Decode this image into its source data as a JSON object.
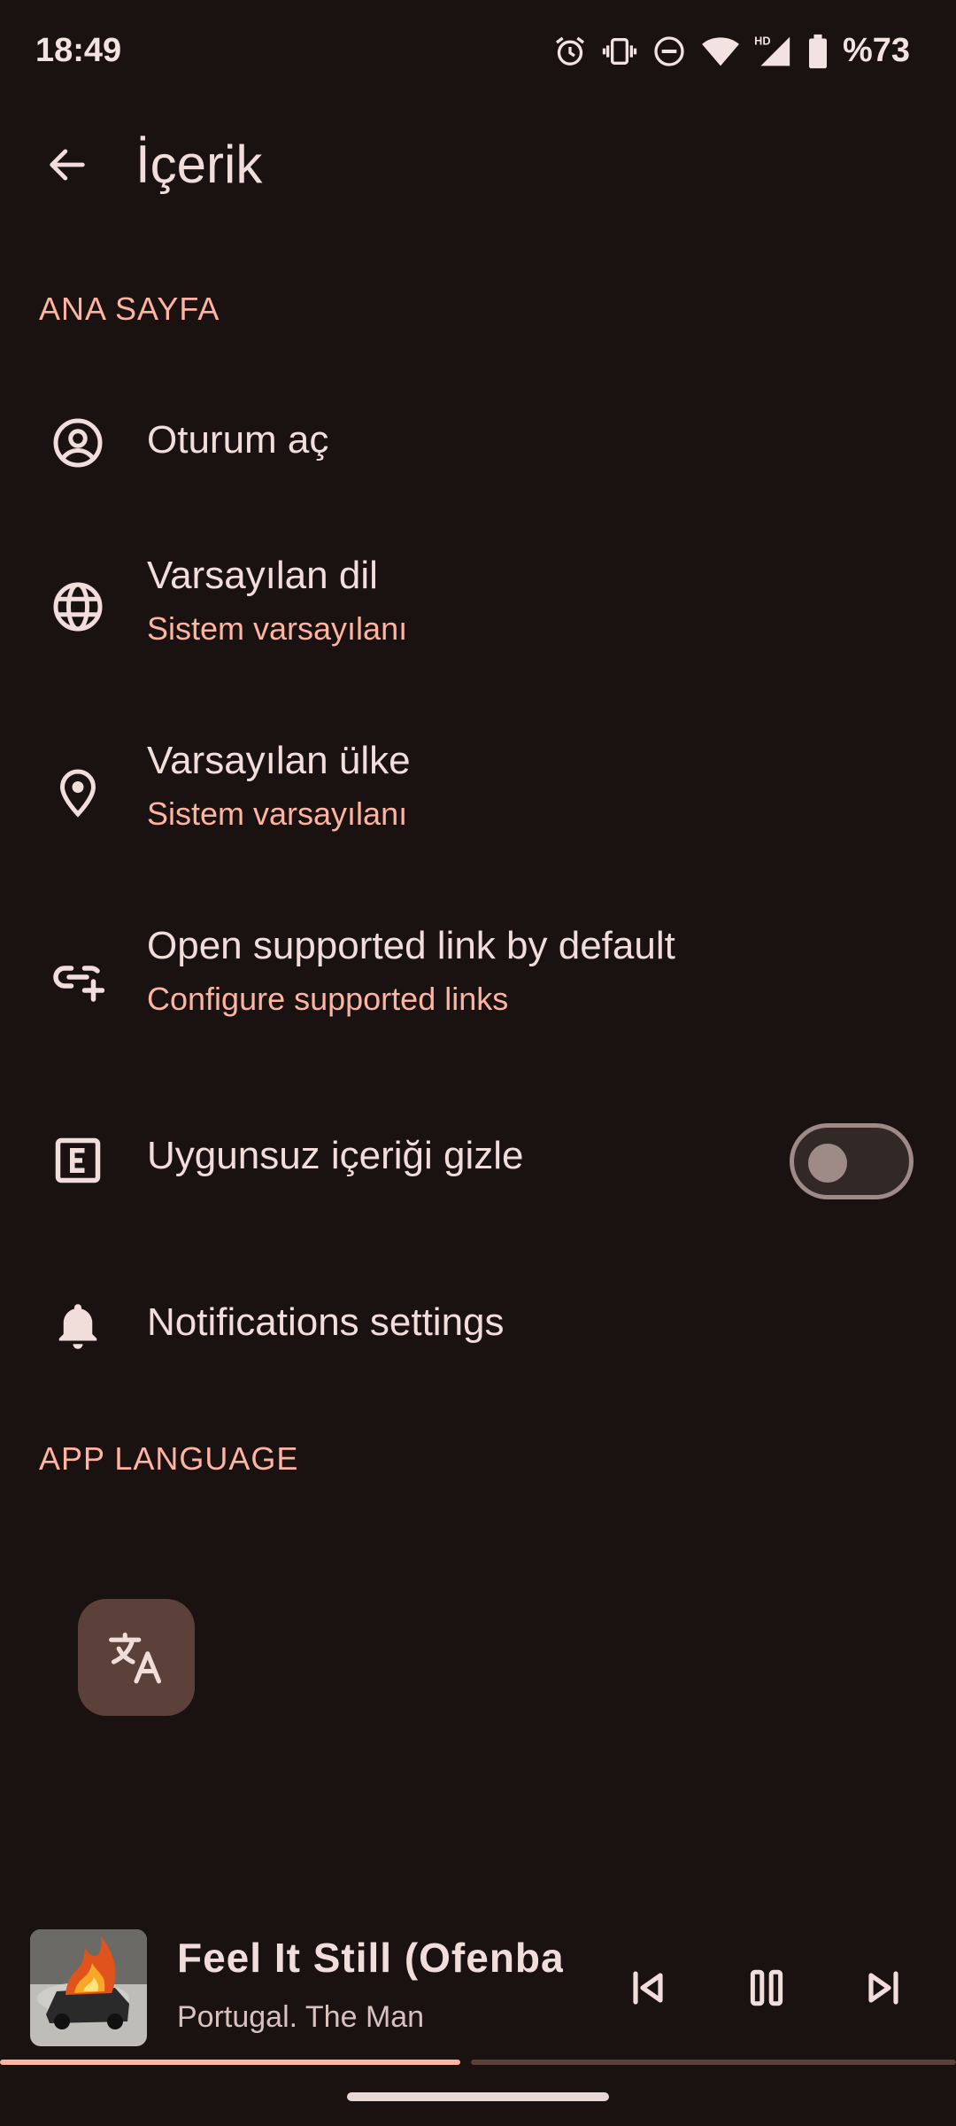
{
  "status_bar": {
    "time": "18:49",
    "battery_text": "%73",
    "icons": [
      "alarm-icon",
      "vibrate-icon",
      "dnd-icon",
      "wifi-icon",
      "hd-signal-icon",
      "battery-icon"
    ]
  },
  "app_bar": {
    "title": "İçerik",
    "back_icon": "arrow-back-icon"
  },
  "sections": {
    "home": "ANA SAYFA",
    "app_language": "APP LANGUAGE"
  },
  "settings": {
    "sign_in": {
      "title": "Oturum aç",
      "icon": "account-circle-icon"
    },
    "default_language": {
      "title": "Varsayılan dil",
      "subtitle": "Sistem varsayılanı",
      "icon": "globe-icon"
    },
    "default_country": {
      "title": "Varsayılan ülke",
      "subtitle": "Sistem varsayılanı",
      "icon": "location-pin-icon"
    },
    "supported_links": {
      "title": "Open supported link by default",
      "subtitle": "Configure supported links",
      "icon": "add-link-icon"
    },
    "hide_explicit": {
      "title": "Uygunsuz içeriği gizle",
      "icon": "explicit-icon",
      "enabled": false
    },
    "notifications": {
      "title": "Notifications settings",
      "icon": "bell-icon"
    }
  },
  "app_language": {
    "button_icon": "translate-icon"
  },
  "mini_player": {
    "title": "Feel It Still (Ofenba",
    "artist": "Portugal. The Man",
    "progress": 0.48,
    "controls": [
      "skip-previous-icon",
      "pause-icon",
      "skip-next-icon"
    ]
  },
  "colors": {
    "background": "#1a1111",
    "accent": "#ffb4a2",
    "text": "#f1dedb",
    "fab": "#5c403a"
  }
}
